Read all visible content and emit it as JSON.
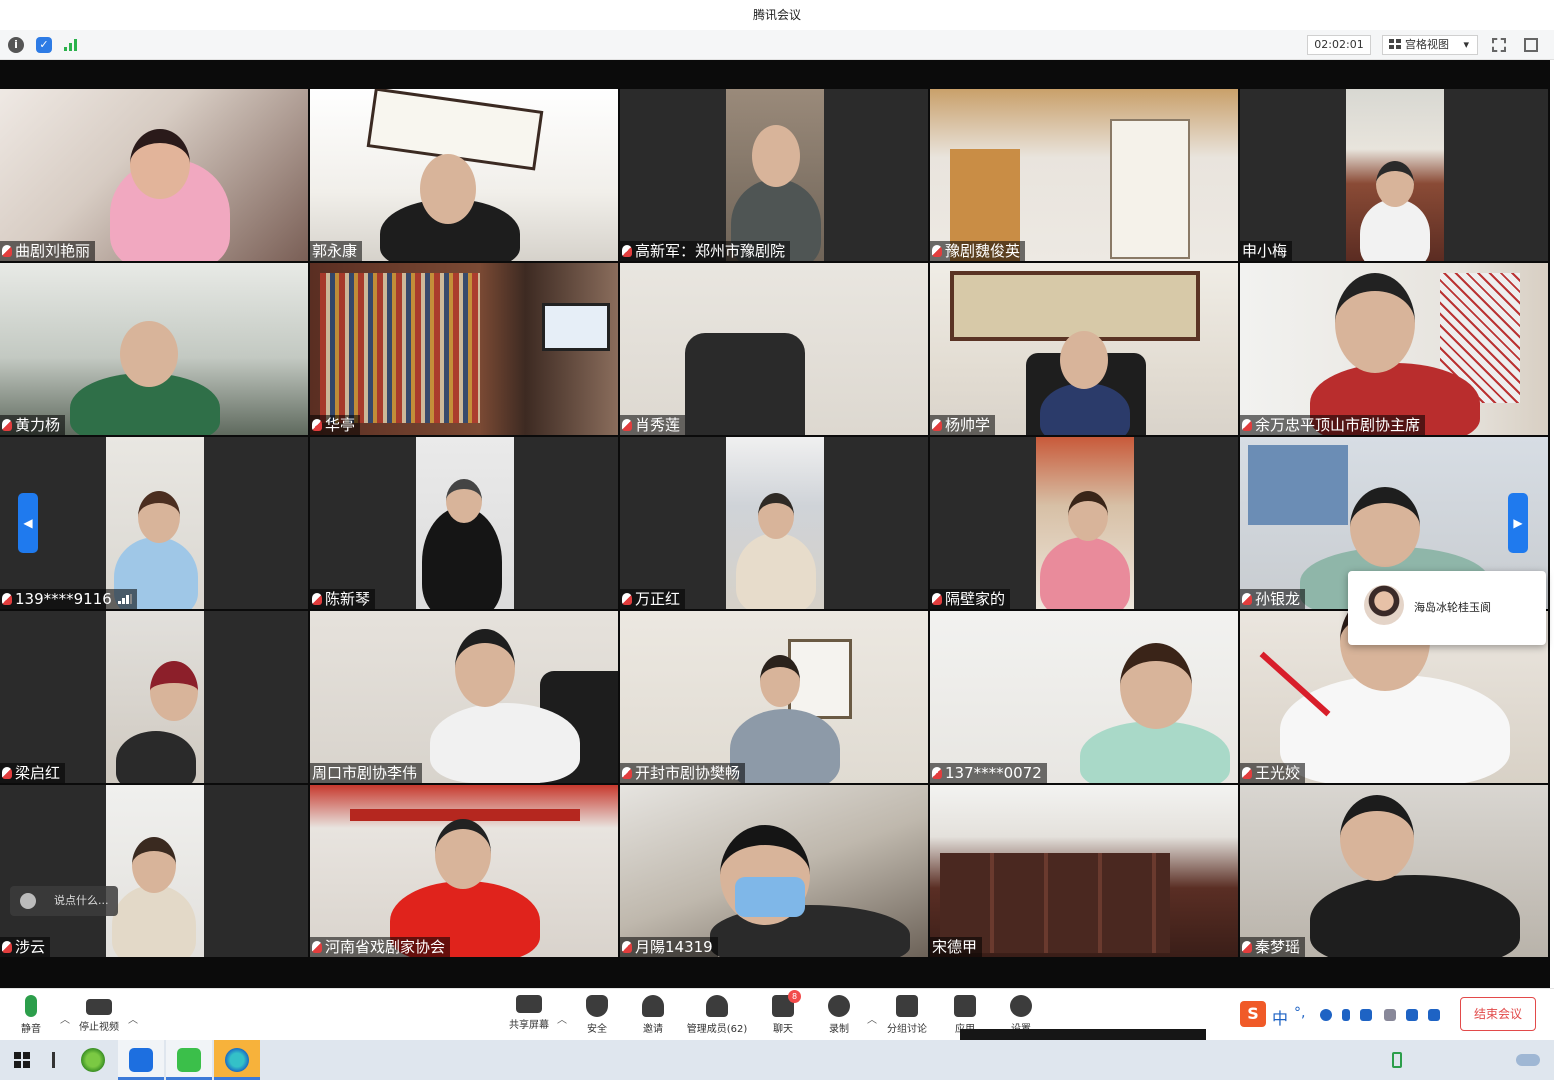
{
  "window": {
    "title": "腾讯会议"
  },
  "topbar": {
    "timer": "02:02:01",
    "view_label": "宫格视图",
    "view_caret": "▾"
  },
  "participants": [
    {
      "name": "曲剧刘艳丽",
      "mic": true
    },
    {
      "name": "郭永康",
      "mic": false
    },
    {
      "name": "高新军：郑州市豫剧院",
      "mic": true
    },
    {
      "name": "豫剧魏俊英",
      "mic": true
    },
    {
      "name": "申小梅",
      "mic": false
    },
    {
      "name": "黄力杨",
      "mic": true
    },
    {
      "name": "华亭",
      "mic": true
    },
    {
      "name": "肖秀莲",
      "mic": true
    },
    {
      "name": "杨帅学",
      "mic": true
    },
    {
      "name": "余万忠平顶山市剧协主席",
      "mic": true
    },
    {
      "name": "139****9116",
      "mic": true
    },
    {
      "name": "陈新琴",
      "mic": true
    },
    {
      "name": "万正红",
      "mic": true
    },
    {
      "name": "隔壁家的",
      "mic": true
    },
    {
      "name": "孙银龙",
      "mic": true
    },
    {
      "name": "梁启红",
      "mic": true
    },
    {
      "name": "周口市剧协李伟",
      "mic": false
    },
    {
      "name": "开封市剧协樊畅",
      "mic": true
    },
    {
      "name": "137****0072",
      "mic": true
    },
    {
      "name": "王光姣",
      "mic": true
    },
    {
      "name": "涉云",
      "mic": true
    },
    {
      "name": "河南省戏剧家协会",
      "mic": true
    },
    {
      "name": "月陽14319",
      "mic": true
    },
    {
      "name": "宋德甲",
      "mic": false
    },
    {
      "name": "秦梦瑶",
      "mic": true
    }
  ],
  "chat_input": {
    "placeholder": "说点什么..."
  },
  "popup": {
    "name": "海岛冰轮桂玉阆"
  },
  "toolbar": {
    "mute": "静音",
    "stop_video": "停止视频",
    "share_screen": "共享屏幕",
    "security": "安全",
    "invite": "邀请",
    "manage_members": "管理成员(62)",
    "chat": "聊天",
    "chat_badge": "8",
    "record": "录制",
    "breakout": "分组讨论",
    "apps": "应用",
    "settings": "设置",
    "end_meeting": "结束会议"
  },
  "ime": {
    "s_logo": "S",
    "mode": "中",
    "punct": "°,"
  },
  "colors": {
    "accent": "#1f7aee",
    "end": "#e24a4a",
    "stage": "#0b0b0b"
  }
}
